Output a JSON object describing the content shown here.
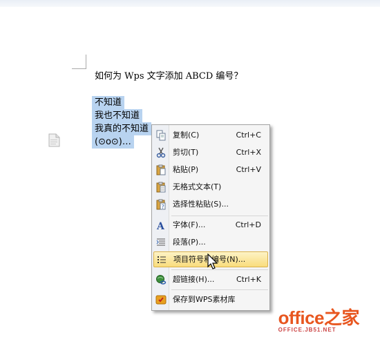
{
  "document": {
    "title": "如何为 Wps 文字添加 ABCD 编号？",
    "selected_lines": [
      "不知道",
      "我也不知道",
      "我真的不知道",
      "(⊙o⊙)…"
    ]
  },
  "context_menu": {
    "items": [
      {
        "label": "复制(C)",
        "shortcut": "Ctrl+C",
        "icon": "copy-icon"
      },
      {
        "label": "剪切(T)",
        "shortcut": "Ctrl+X",
        "icon": "scissors-icon"
      },
      {
        "label": "粘贴(P)",
        "shortcut": "Ctrl+V",
        "icon": "paste-icon"
      },
      {
        "label": "无格式文本(T)",
        "shortcut": "",
        "icon": "paste-text-icon"
      },
      {
        "label": "选择性粘贴(S)...",
        "shortcut": "",
        "icon": "paste-special-icon"
      },
      {
        "label": "字体(F)...",
        "shortcut": "Ctrl+D",
        "icon": "font-icon"
      },
      {
        "label": "段落(P)...",
        "shortcut": "",
        "icon": "paragraph-icon"
      },
      {
        "label": "项目符号和编号(N)...",
        "shortcut": "",
        "icon": "bullets-numbering-icon",
        "highlighted": true
      },
      {
        "label": "超链接(H)...",
        "shortcut": "Ctrl+K",
        "icon": "hyperlink-icon"
      },
      {
        "label": "保存到WPS素材库",
        "shortcut": "",
        "icon": "save-library-icon"
      }
    ]
  },
  "watermark": {
    "main": "office之家",
    "sub": "OFFICE.JB51.NET"
  },
  "colors": {
    "selection": "#b8d3f0",
    "highlight": "#f9dc7c",
    "watermark": "#e8561f"
  }
}
